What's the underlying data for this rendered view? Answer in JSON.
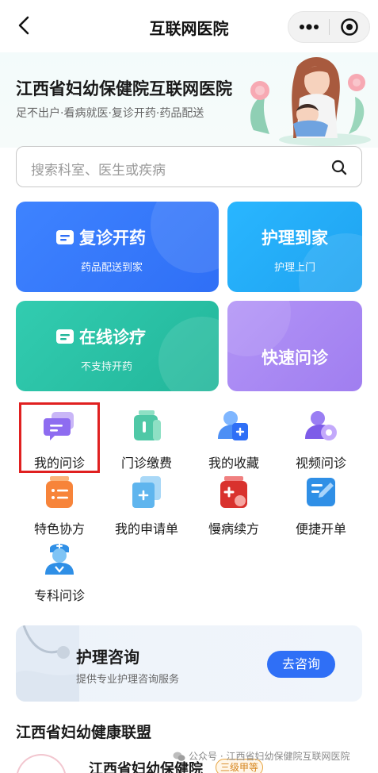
{
  "nav": {
    "title": "互联网医院"
  },
  "hero": {
    "title": "江西省妇幼保健院互联网医院",
    "subtitle": "足不出户·看病就医·复诊开药·药品配送"
  },
  "search": {
    "placeholder": "搜索科室、医生或疾病"
  },
  "service_cards": [
    {
      "title": "复诊开药",
      "subtitle": "药品配送到家"
    },
    {
      "title": "护理到家",
      "subtitle": "护理上门"
    },
    {
      "title": "在线诊疗",
      "subtitle": "不支持开药"
    },
    {
      "title": "快速问诊"
    }
  ],
  "grid": [
    {
      "label": "我的问诊",
      "icon": "chat-icon"
    },
    {
      "label": "门诊缴费",
      "icon": "payment-icon"
    },
    {
      "label": "我的收藏",
      "icon": "favorite-icon"
    },
    {
      "label": "视频问诊",
      "icon": "video-icon"
    },
    {
      "label": "特色协方",
      "icon": "prescription-icon"
    },
    {
      "label": "我的申请单",
      "icon": "application-icon"
    },
    {
      "label": "慢病续方",
      "icon": "chronic-icon"
    },
    {
      "label": "便捷开单",
      "icon": "edit-icon"
    },
    {
      "label": "专科问诊",
      "icon": "doctor-icon"
    }
  ],
  "banner": {
    "title": "护理咨询",
    "subtitle": "提供专业护理咨询服务",
    "button": "去咨询"
  },
  "alliance": {
    "title": "江西省妇幼健康联盟",
    "org_name": "江西省妇幼保健院",
    "badge": "三级甲等"
  },
  "watermark": "公众号 · 江西省妇幼保健院互联网医院",
  "colors": {
    "primary_blue": "#2f6ff6",
    "sky_blue": "#29b6ff",
    "teal": "#32ccb0",
    "purple": "#a07ef0",
    "highlight_red": "#e02020"
  }
}
